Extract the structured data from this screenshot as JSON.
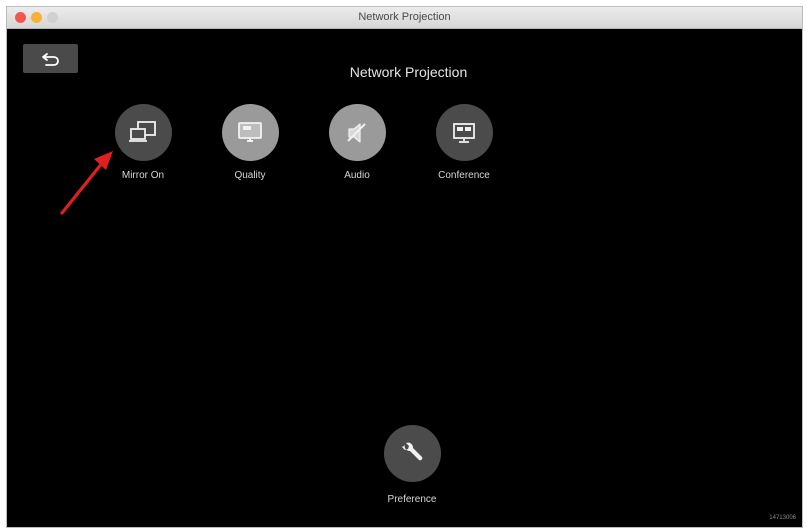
{
  "window": {
    "title": "Network Projection"
  },
  "screen": {
    "title": "Network Projection"
  },
  "features": [
    {
      "label": "Mirror On",
      "icon": "mirror-screens-icon"
    },
    {
      "label": "Quality",
      "icon": "quality-monitor-icon"
    },
    {
      "label": "Audio",
      "icon": "audio-speaker-icon"
    },
    {
      "label": "Conference",
      "icon": "conference-screen-icon"
    }
  ],
  "preference": {
    "label": "Preference",
    "icon": "wrench-icon"
  },
  "footer": {
    "code": "14713006"
  },
  "colors": {
    "background": "#000000",
    "button_dark": "#4b4b4b",
    "button_light": "#9a9a9a",
    "annotation_arrow": "#e0201f"
  }
}
